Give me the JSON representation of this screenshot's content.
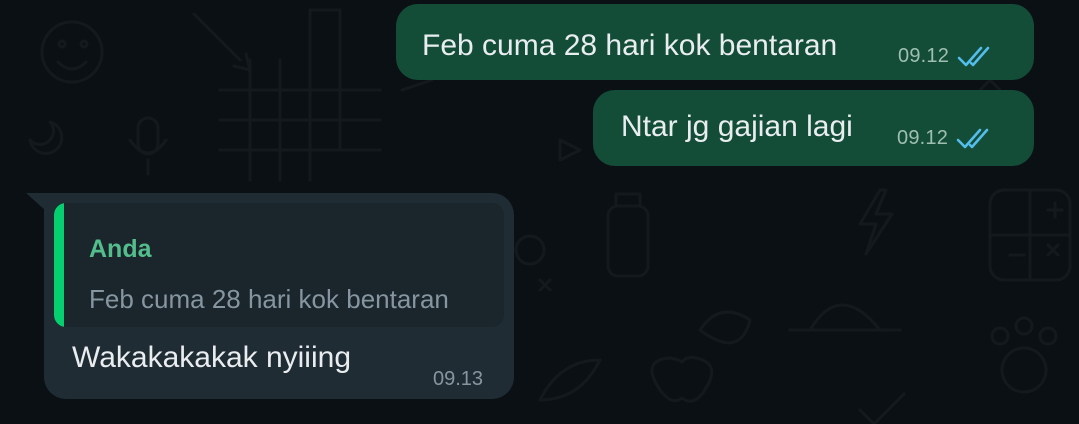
{
  "theme": {
    "background": "#0b1014",
    "outgoing_bubble": "#134d37",
    "incoming_bubble": "#1f2c34",
    "quote_accent": "#06cf6f",
    "read_tick_color": "#53bdeb"
  },
  "messages": [
    {
      "direction": "outgoing",
      "text": "Feb cuma 28 hari kok bentaran",
      "time": "09.12",
      "status_icon": "double-check-read-icon"
    },
    {
      "direction": "outgoing",
      "text": "Ntar jg gajian lagi",
      "time": "09.12",
      "status_icon": "double-check-read-icon"
    },
    {
      "direction": "incoming",
      "quoted": {
        "author": "Anda",
        "text": "Feb cuma 28 hari kok bentaran"
      },
      "text": "Wakakakakak nyiiing",
      "time": "09.13"
    }
  ]
}
